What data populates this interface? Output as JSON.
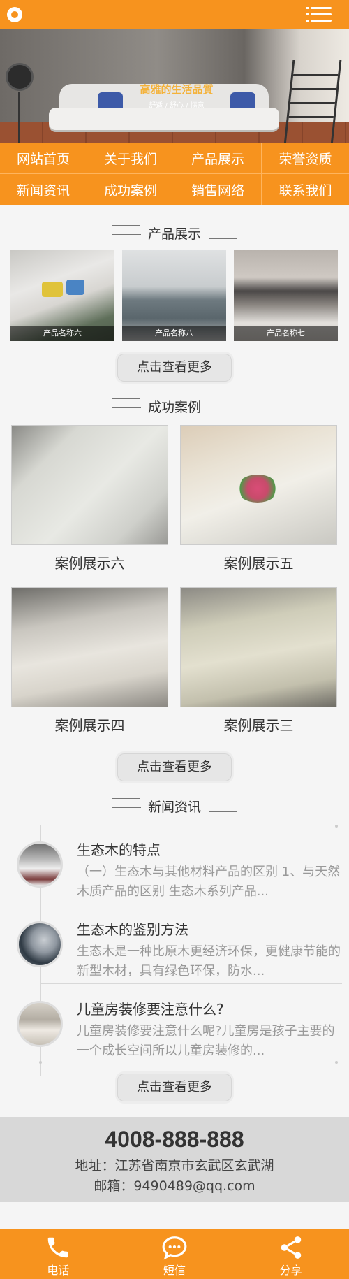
{
  "header": {
    "logo_icon": "logo-icon",
    "menu_icon": "menu-icon"
  },
  "banner": {
    "headline": "高雅的生活品質",
    "tagline": "舒适 / 舒心 / 惬意"
  },
  "nav": {
    "items": [
      "网站首页",
      "关于我们",
      "产品展示",
      "荣誉资质",
      "新闻资讯",
      "成功案例",
      "销售网络",
      "联系我们"
    ]
  },
  "products": {
    "title": "产品展示",
    "items": [
      {
        "caption": "产品名称六"
      },
      {
        "caption": "产品名称八"
      },
      {
        "caption": "产品名称七"
      }
    ],
    "more": "点击查看更多"
  },
  "cases": {
    "title": "成功案例",
    "items": [
      {
        "caption": "案例展示六"
      },
      {
        "caption": "案例展示五"
      },
      {
        "caption": "案例展示四"
      },
      {
        "caption": "案例展示三"
      }
    ],
    "more": "点击查看更多"
  },
  "news": {
    "title": "新闻资讯",
    "items": [
      {
        "title": "生态木的特点",
        "desc": "（一）生态木与其他材料产品的区别 1、与天然木质产品的区别 生态木系列产品..."
      },
      {
        "title": "生态木的鉴别方法",
        "desc": "生态木是一种比原木更经济环保，更健康节能的新型木材，具有绿色环保，防水..."
      },
      {
        "title": "儿童房装修要注意什么?",
        "desc": "儿童房装修要注意什么呢?儿童房是孩子主要的一个成长空间所以儿童房装修的..."
      }
    ],
    "more": "点击查看更多"
  },
  "contact": {
    "phone": "4008-888-888",
    "address": "地址：江苏省南京市玄武区玄武湖",
    "email": "邮箱：9490489@qq.com"
  },
  "bottombar": {
    "items": [
      {
        "label": "电话",
        "icon": "phone-icon"
      },
      {
        "label": "短信",
        "icon": "sms-icon"
      },
      {
        "label": "分享",
        "icon": "share-icon"
      }
    ]
  },
  "colors": {
    "accent": "#f7931e",
    "contact_bg": "#d8d8d8"
  }
}
